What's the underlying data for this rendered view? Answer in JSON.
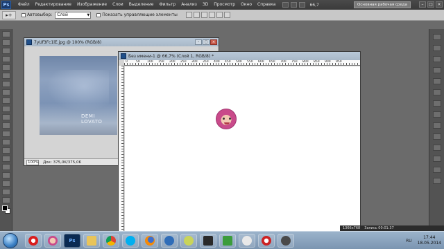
{
  "app": {
    "logo": "Ps",
    "menu": [
      "Файл",
      "Редактирование",
      "Изображение",
      "Слои",
      "Выделение",
      "Фильтр",
      "Анализ",
      "3D",
      "Просмотр",
      "Окно",
      "Справка"
    ],
    "zoom": "66,7",
    "workspace": "Основная рабочая среда",
    "window_controls": [
      "–",
      "□",
      "×"
    ]
  },
  "options_bar": {
    "tool_glyph": "▸+",
    "auto_select_label": "Автовыбор:",
    "auto_select_value": "Слой",
    "show_controls_label": "Показать управляющие элементы"
  },
  "doc1": {
    "title": "7yUf3Fc1lE.jpg @ 100% (RGB/8)",
    "zoom": "100%",
    "status": "Док: 375,0K/375,0K",
    "watermark": "DEMI LOVATO"
  },
  "doc2": {
    "title": "Без имени-1 @ 66,7% (Слой 1, RGB/8) *",
    "ruler_ticks": [
      "0",
      "50",
      "100",
      "150",
      "200",
      "250",
      "300",
      "350",
      "400",
      "450",
      "500",
      "550",
      "600",
      "650",
      "700",
      "750",
      "800",
      "850",
      "900",
      "950"
    ]
  },
  "timeline": {
    "left": "1366x768",
    "right": "Запись 00:01:37"
  },
  "taskbar": {
    "apps": [
      "",
      "",
      "Ps",
      "",
      "",
      "",
      "",
      "",
      "",
      "",
      "",
      "",
      "",
      ""
    ],
    "lang": "RU",
    "time": "17:44",
    "date": "18.05.2014"
  }
}
